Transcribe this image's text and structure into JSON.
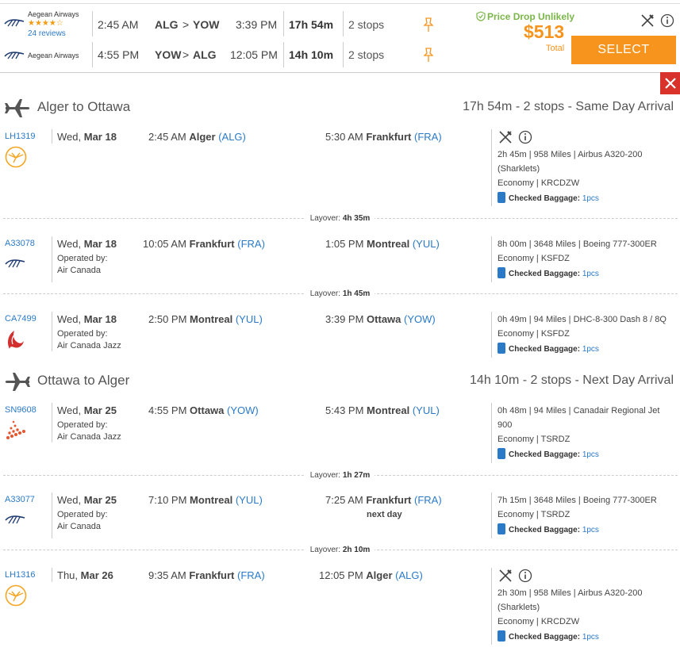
{
  "summary": {
    "rows": [
      {
        "airline": "Aegean Airways",
        "stars": "★★★★☆",
        "reviews": "24 reviews",
        "dep_time": "2:45 AM",
        "origin": "ALG",
        "arrow": ">",
        "dest": "YOW",
        "arr_time": "3:39 PM",
        "duration": "17h 54m",
        "stops": "2 stops"
      },
      {
        "airline": "Aegean Airways",
        "dep_time": "4:55 PM",
        "origin": "YOW",
        "arrow": ">",
        "dest": "ALG",
        "arr_time": "12:05 PM",
        "duration": "14h 10m",
        "stops": "2 stops"
      }
    ],
    "price_drop": "Price Drop Unlikely",
    "price": "$513",
    "price_label": "Total",
    "select_label": "SELECT"
  },
  "outbound": {
    "title": "Alger to Ottawa",
    "summary": "17h 54m - 2 stops - Same Day Arrival",
    "segments": [
      {
        "flight": "LH1319",
        "day": "Wed,",
        "date": "Mar 18",
        "dep_time": "2:45 AM",
        "dep_city": "Alger",
        "dep_code": "(ALG)",
        "arr_time": "5:30 AM",
        "arr_city": "Frankfurt",
        "arr_code": "(FRA)",
        "info1": "2h 45m | 958 Miles | Airbus A320-200",
        "info2": "(Sharklets)",
        "cabin": "Economy | KRCDZW",
        "bag_label": "Checked Baggage:",
        "bag_value": "1pcs"
      },
      {
        "flight": "A33078",
        "day": "Wed,",
        "date": "Mar 18",
        "op_label": "Operated by:",
        "op_name": "Air Canada",
        "dep_time": "10:05 AM",
        "dep_city": "Frankfurt",
        "dep_code": "(FRA)",
        "arr_time": "1:05 PM",
        "arr_city": "Montreal",
        "arr_code": "(YUL)",
        "info1": "8h 00m | 3648 Miles | Boeing 777-300ER",
        "cabin": "Economy | KSFDZ",
        "bag_label": "Checked Baggage:",
        "bag_value": "1pcs"
      },
      {
        "flight": "CA7499",
        "day": "Wed,",
        "date": "Mar 18",
        "op_label": "Operated by:",
        "op_name": "Air Canada Jazz",
        "dep_time": "2:50 PM",
        "dep_city": "Montreal",
        "dep_code": "(YUL)",
        "arr_time": "3:39 PM",
        "arr_city": "Ottawa",
        "arr_code": "(YOW)",
        "info1": "0h 49m | 94 Miles | DHC-8-300 Dash 8 / 8Q",
        "cabin": "Economy | KSFDZ",
        "bag_label": "Checked Baggage:",
        "bag_value": "1pcs"
      }
    ],
    "layovers": [
      {
        "label": "Layover:",
        "value": "4h 35m"
      },
      {
        "label": "Layover:",
        "value": "1h 45m"
      }
    ]
  },
  "return": {
    "title": "Ottawa to Alger",
    "summary": "14h 10m - 2 stops - Next Day Arrival",
    "segments": [
      {
        "flight": "SN9608",
        "day": "Wed,",
        "date": "Mar 25",
        "op_label": "Operated by:",
        "op_name": "Air Canada Jazz",
        "dep_time": "4:55 PM",
        "dep_city": "Ottawa",
        "dep_code": "(YOW)",
        "arr_time": "5:43 PM",
        "arr_city": "Montreal",
        "arr_code": "(YUL)",
        "info1": "0h 48m | 94 Miles | Canadair Regional Jet",
        "info2": "900",
        "cabin": "Economy | TSRDZ",
        "bag_label": "Checked Baggage:",
        "bag_value": "1pcs"
      },
      {
        "flight": "A33077",
        "day": "Wed,",
        "date": "Mar 25",
        "op_label": "Operated by:",
        "op_name": "Air Canada",
        "dep_time": "7:10 PM",
        "dep_city": "Montreal",
        "dep_code": "(YUL)",
        "arr_time": "7:25 AM",
        "arr_city": "Frankfurt",
        "arr_code": "(FRA)",
        "next_day": "next day",
        "info1": "7h 15m | 3648 Miles | Boeing 777-300ER",
        "cabin": "Economy | TSRDZ",
        "bag_label": "Checked Baggage:",
        "bag_value": "1pcs"
      },
      {
        "flight": "LH1316",
        "day": "Thu,",
        "date": "Mar 26",
        "dep_time": "9:35 AM",
        "dep_city": "Frankfurt",
        "dep_code": "(FRA)",
        "arr_time": "12:05 PM",
        "arr_city": "Alger",
        "arr_code": "(ALG)",
        "info1": "2h 30m | 958 Miles | Airbus A320-200",
        "info2": "(Sharklets)",
        "cabin": "Economy | KRCDZW",
        "bag_label": "Checked Baggage:",
        "bag_value": "1pcs"
      }
    ],
    "layovers": [
      {
        "label": "Layover:",
        "value": "1h 27m"
      },
      {
        "label": "Layover:",
        "value": "2h 10m"
      }
    ]
  },
  "icons": {
    "meal": "fork-knife-icon",
    "info": "info-circle-icon",
    "pin": "pin-icon",
    "shield": "shield-check-icon",
    "close": "close-icon",
    "plane": "airplane-icon",
    "bag": "luggage-icon"
  },
  "colors": {
    "accent": "#f7941d",
    "link": "#2a7ac8",
    "price_drop": "#7ab648",
    "close": "#d9322a"
  }
}
